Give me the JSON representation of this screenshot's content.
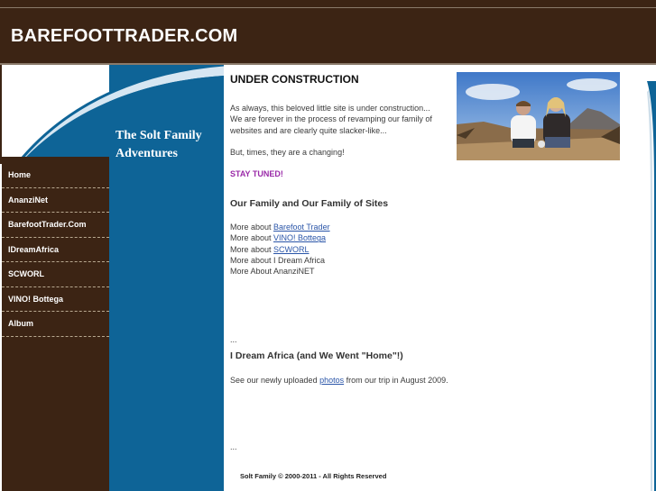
{
  "header": {
    "site_title": "BAREFOOTTRADER.COM"
  },
  "banner": {
    "tagline": "The Solt Family Adventures"
  },
  "nav": {
    "items": [
      {
        "label": "Home"
      },
      {
        "label": "AnanziNet"
      },
      {
        "label": "BarefootTrader.Com"
      },
      {
        "label": "IDreamAfrica"
      },
      {
        "label": "SCWORL"
      },
      {
        "label": "VINO! Bottega"
      },
      {
        "label": "Album"
      }
    ]
  },
  "main": {
    "section1_title": "UNDER CONSTRUCTION",
    "intro": "As always, this beloved little site is under construction... We are forever in the process of revamping our family of websites and are clearly quite slacker-like...",
    "changing": "But, times, they are a changing!",
    "stay_tuned": "STAY TUNED!",
    "section2_title": "Our Family and Our Family of Sites",
    "more_about": [
      {
        "prefix": "More about ",
        "link": "Barefoot Trader"
      },
      {
        "prefix": "More about ",
        "link": "VINO! Bottega"
      },
      {
        "prefix": "More about ",
        "link": "SCWORL"
      },
      {
        "prefix": "More about I Dream Africa",
        "link": ""
      },
      {
        "prefix": "More About AnanziNET",
        "link": ""
      }
    ],
    "ellipsis1": "...",
    "section3_title": "I Dream Africa (and We Went \"Home\"!)",
    "photos_prefix": "See our newly uploaded ",
    "photos_link": "photos",
    "photos_suffix": " from our trip in August 2009.",
    "ellipsis2": "..."
  },
  "footer": {
    "copyright": "Solt Family © 2000-2011 - All Rights Reserved"
  },
  "colors": {
    "header_bg": "#3c2414",
    "blue": "#0e6497",
    "link": "#2a55a8",
    "stay_tuned": "#9a2aa8"
  }
}
